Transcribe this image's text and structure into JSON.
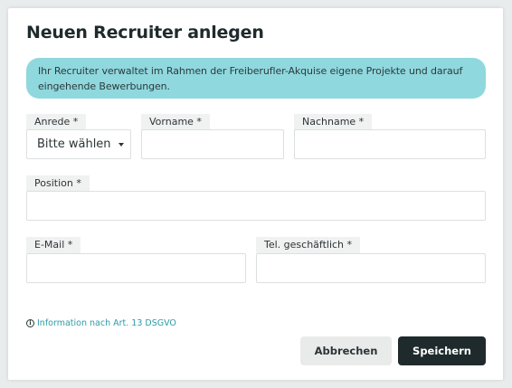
{
  "dialog": {
    "title": "Neuen Recruiter anlegen",
    "info_text": "Ihr Recruiter verwaltet im Rahmen der Freiberufler-Akquise eigene Projekte und darauf eingehende Bewerbungen."
  },
  "form": {
    "salutation": {
      "label": "Anrede *",
      "value": "Bitte wählen"
    },
    "first_name": {
      "label": "Vorname *",
      "value": ""
    },
    "last_name": {
      "label": "Nachname *",
      "value": ""
    },
    "position": {
      "label": "Position *",
      "value": ""
    },
    "email": {
      "label": "E-Mail *",
      "value": ""
    },
    "phone": {
      "label": "Tel. geschäftlich *",
      "value": ""
    }
  },
  "footer": {
    "dsgvo_link": "Information nach Art. 13 DSGVO",
    "cancel_label": "Abbrechen",
    "save_label": "Speichern"
  },
  "colors": {
    "info_box_bg": "#8fd8de",
    "primary_button": "#1f2a2c",
    "link": "#2e9aa6"
  }
}
